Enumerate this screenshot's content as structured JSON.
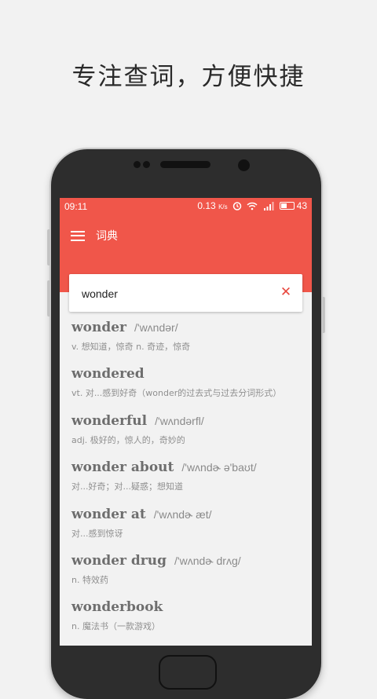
{
  "promo": {
    "title": "专注查词，方便快捷"
  },
  "status_bar": {
    "time": "09:11",
    "speed": "0.13",
    "speed_unit": "K/s",
    "battery": "43"
  },
  "toolbar": {
    "title": "词典"
  },
  "search": {
    "value": "wonder",
    "placeholder": ""
  },
  "results": [
    {
      "word": "wonder",
      "phonetic": "/'wʌndər/",
      "definition": "v. 想知道，惊奇 n. 奇迹，惊奇"
    },
    {
      "word": "wondered",
      "phonetic": "",
      "definition": "vt. 对...感到好奇（wonder的过去式与过去分词形式）"
    },
    {
      "word": "wonderful",
      "phonetic": "/'wʌndərfl/",
      "definition": "adj. 极好的，惊人的，奇妙的"
    },
    {
      "word": "wonder about",
      "phonetic": "/'wʌndɚ ə'baʊt/",
      "definition": "对...好奇；对...疑惑；想知道"
    },
    {
      "word": "wonder at",
      "phonetic": "/'wʌndɚ æt/",
      "definition": "对...感到惊讶"
    },
    {
      "word": "wonder drug",
      "phonetic": "/'wʌndɚ drʌg/",
      "definition": "n. 特效药"
    },
    {
      "word": "wonderbook",
      "phonetic": "",
      "definition": "n. 魔法书（一款游戏）"
    }
  ],
  "colors": {
    "accent": "#f0564a",
    "clear_icon": "#e8473e",
    "background": "#f2f2f2"
  },
  "icons": [
    "menu-icon",
    "clear-icon",
    "alarm-icon",
    "wifi-icon",
    "signal-icon",
    "battery-icon"
  ]
}
